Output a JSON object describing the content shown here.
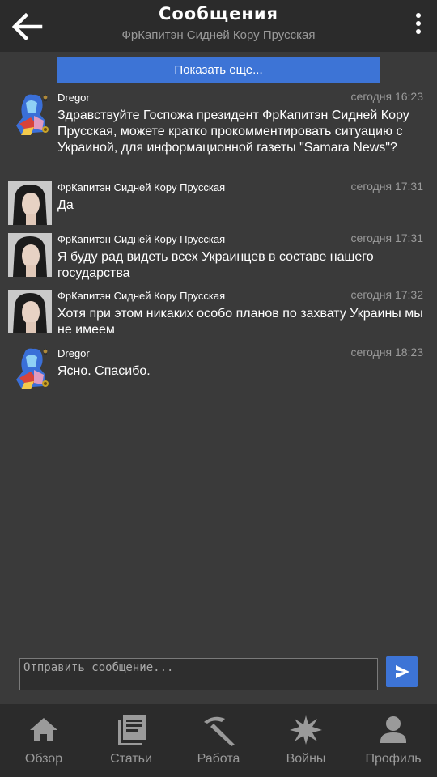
{
  "header": {
    "title": "Сообщения",
    "subtitle": "ФрКапитэн Сидней Кору Прусская"
  },
  "show_more_label": "Показать еще...",
  "messages": [
    {
      "author": "Dregor",
      "time": "сегодня 16:23",
      "text": "Здравствуйте Госпожа президент ФрКапитэн Сидней Кору Прусская, можете кратко прокомментировать ситуацию с Украиной, для информационной газеты \"Samara News\"?"
    },
    {
      "author": "ФрКапитэн Сидней Кору Прусская",
      "time": "сегодня 17:31",
      "text": "Да"
    },
    {
      "author": "ФрКапитэн Сидней Кору Прусская",
      "time": "сегодня 17:31",
      "text": "Я буду рад видеть всех Украинцев в составе нашего государства"
    },
    {
      "author": "ФрКапитэн Сидней Кору Прусская",
      "time": "сегодня 17:32",
      "text": "Хотя при этом никаких особо планов по захвату Украины мы не имеем"
    },
    {
      "author": "Dregor",
      "time": "сегодня 18:23",
      "text": "Ясно. Спасибо."
    }
  ],
  "composer": {
    "placeholder": "Отправить сообщение..."
  },
  "tabs": [
    {
      "label": "Обзор",
      "icon": "home-icon"
    },
    {
      "label": "Статьи",
      "icon": "articles-icon"
    },
    {
      "label": "Работа",
      "icon": "pickaxe-icon"
    },
    {
      "label": "Войны",
      "icon": "explosion-icon"
    },
    {
      "label": "Профиль",
      "icon": "profile-icon"
    }
  ],
  "colors": {
    "background": "#3a3a3a",
    "bars": "#2b2b2b",
    "accent": "#3d74d6",
    "muted_text": "#9a9a9a"
  }
}
